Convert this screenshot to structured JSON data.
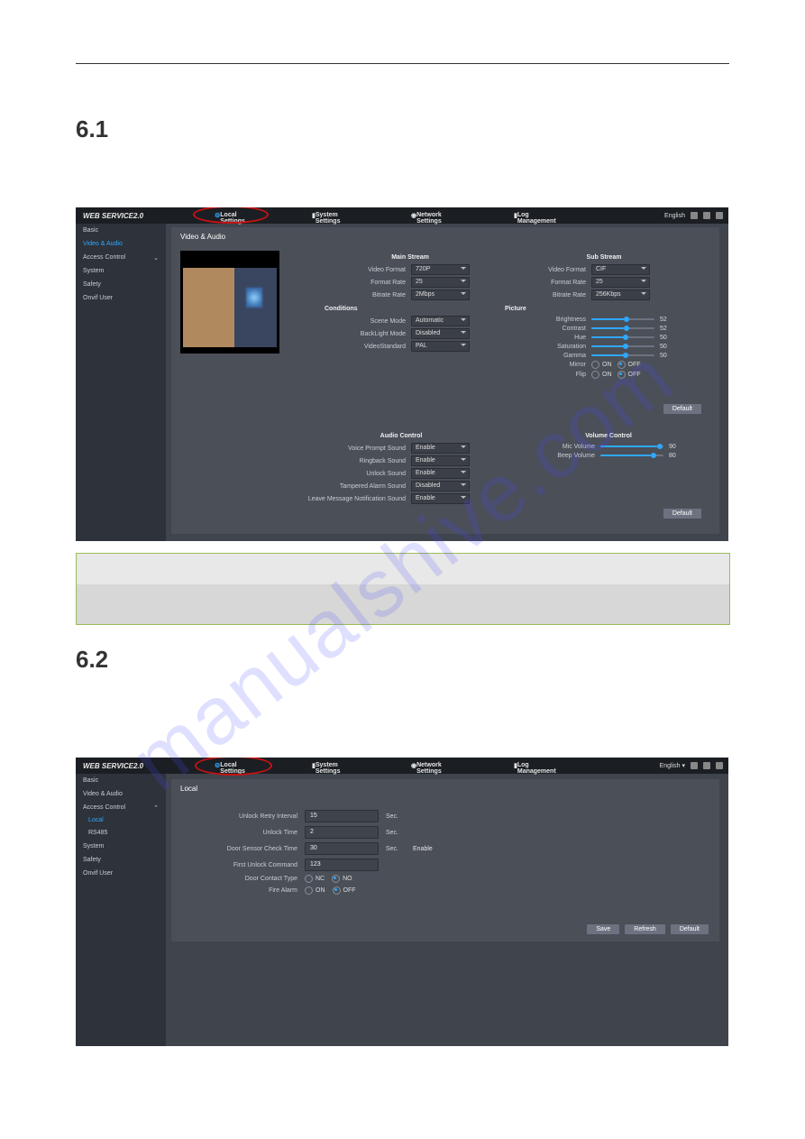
{
  "watermark": "manualshive.com",
  "sections": {
    "s1": "6.1",
    "s2": "6.2"
  },
  "header": {
    "brand": "WEB SERVICE2.0",
    "nav": {
      "local": "Local Settings",
      "system": "System Settings",
      "network": "Network Settings",
      "log": "Log Management"
    },
    "language": "English"
  },
  "shot1": {
    "sidebar": {
      "basic": "Basic",
      "video_audio": "Video & Audio",
      "access_control": "Access Control",
      "system": "System",
      "safety": "Safety",
      "onvif": "Onvif User"
    },
    "panel_title": "Video & Audio",
    "main_stream": {
      "title": "Main Stream",
      "video_format": {
        "label": "Video Format",
        "value": "720P"
      },
      "format_rate": {
        "label": "Format Rate",
        "value": "25"
      },
      "bitrate": {
        "label": "Bitrate Rate",
        "value": "2Mbps"
      }
    },
    "conditions": {
      "title": "Conditions",
      "scene_mode": {
        "label": "Scene Mode",
        "value": "Automatic"
      },
      "backlight_mode": {
        "label": "BackLight Mode",
        "value": "Disabled"
      },
      "video_standard": {
        "label": "VideoStandard",
        "value": "PAL"
      }
    },
    "sub_stream": {
      "title": "Sub Stream",
      "video_format": {
        "label": "Video Format",
        "value": "CIF"
      },
      "format_rate": {
        "label": "Format Rate",
        "value": "25"
      },
      "bitrate": {
        "label": "Bitrate Rate",
        "value": "256Kbps"
      }
    },
    "picture": {
      "title": "Picture",
      "brightness": {
        "label": "Brightness",
        "value": "52"
      },
      "contrast": {
        "label": "Contrast",
        "value": "52"
      },
      "hue": {
        "label": "Hue",
        "value": "50"
      },
      "saturation": {
        "label": "Saturation",
        "value": "50"
      },
      "gamma": {
        "label": "Gamma",
        "value": "50"
      },
      "mirror": {
        "label": "Mirror",
        "on": "ON",
        "off": "OFF"
      },
      "flip": {
        "label": "Flip",
        "on": "ON",
        "off": "OFF"
      }
    },
    "audio_control": {
      "title": "Audio Control",
      "voice_prompt": {
        "label": "Voice Prompt Sound",
        "value": "Enable"
      },
      "ringback": {
        "label": "Ringback Sound",
        "value": "Enable"
      },
      "unlock": {
        "label": "Unlock Sound",
        "value": "Enable"
      },
      "tampered": {
        "label": "Tampered Alarm Sound",
        "value": "Disabled"
      },
      "leave_msg": {
        "label": "Leave Message Notification Sound",
        "value": "Enable"
      }
    },
    "volume_control": {
      "title": "Volume Control",
      "mic": {
        "label": "Mic Volume",
        "value": "90"
      },
      "beep": {
        "label": "Beep Volume",
        "value": "80"
      }
    },
    "default_btn": "Default"
  },
  "shot2": {
    "sidebar": {
      "basic": "Basic",
      "video_audio": "Video & Audio",
      "access_control": "Access Control",
      "local": "Local",
      "rs485": "RS485",
      "system": "System",
      "safety": "Safety",
      "onvif": "Onvif User"
    },
    "panel_title": "Local",
    "fields": {
      "unlock_retry": {
        "label": "Unlock Retry Interval",
        "value": "15",
        "unit": "Sec."
      },
      "unlock_time": {
        "label": "Unlock Time",
        "value": "2",
        "unit": "Sec."
      },
      "door_sensor": {
        "label": "Door Sensor Check Time",
        "value": "30",
        "unit": "Sec.",
        "enable": "Enable"
      },
      "first_unlock": {
        "label": "First Unlock Command",
        "value": "123"
      },
      "door_contact": {
        "label": "Door Contact Type",
        "nc": "NC",
        "no": "NO"
      },
      "fire_alarm": {
        "label": "Fire Alarm",
        "on": "ON",
        "off": "OFF"
      }
    },
    "buttons": {
      "save": "Save",
      "refresh": "Refresh",
      "default": "Default"
    }
  }
}
